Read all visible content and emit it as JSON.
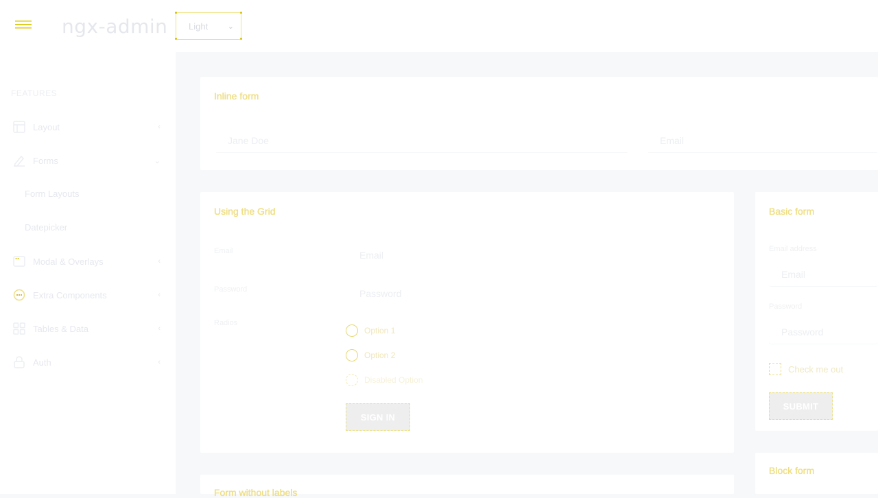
{
  "header": {
    "brand": "ngx-admin",
    "theme_select": {
      "selected": "Light"
    }
  },
  "sidebar": {
    "section_title": "FEATURES",
    "items": [
      {
        "label": "Layout",
        "icon": "layout-icon"
      },
      {
        "label": "Forms",
        "icon": "edit-icon"
      },
      {
        "label": "Modal & Overlays",
        "icon": "browser-icon"
      },
      {
        "label": "Extra Components",
        "icon": "message-circle-icon"
      },
      {
        "label": "Tables & Data",
        "icon": "grid-icon"
      },
      {
        "label": "Auth",
        "icon": "lock-icon"
      }
    ],
    "forms_sub": [
      "Form Layouts",
      "Datepicker"
    ]
  },
  "inline_form": {
    "title": "Inline form",
    "name_placeholder": "Jane Doe",
    "email_placeholder": "Email"
  },
  "grid_form": {
    "title": "Using the Grid",
    "email_label": "Email",
    "email_placeholder": "Email",
    "password_label": "Password",
    "password_placeholder": "Password",
    "radios_label": "Radios",
    "options": [
      "Option 1",
      "Option 2",
      "Disabled Option"
    ],
    "sign_in": "SIGN IN"
  },
  "basic_form": {
    "title": "Basic form",
    "email_label": "Email address",
    "email_placeholder": "Email",
    "password_label": "Password",
    "password_placeholder": "Password",
    "checkbox_label": "Check me out",
    "submit": "SUBMIT"
  },
  "block_form": {
    "title": "Block form"
  },
  "no_labels_form": {
    "title": "Form without labels"
  }
}
